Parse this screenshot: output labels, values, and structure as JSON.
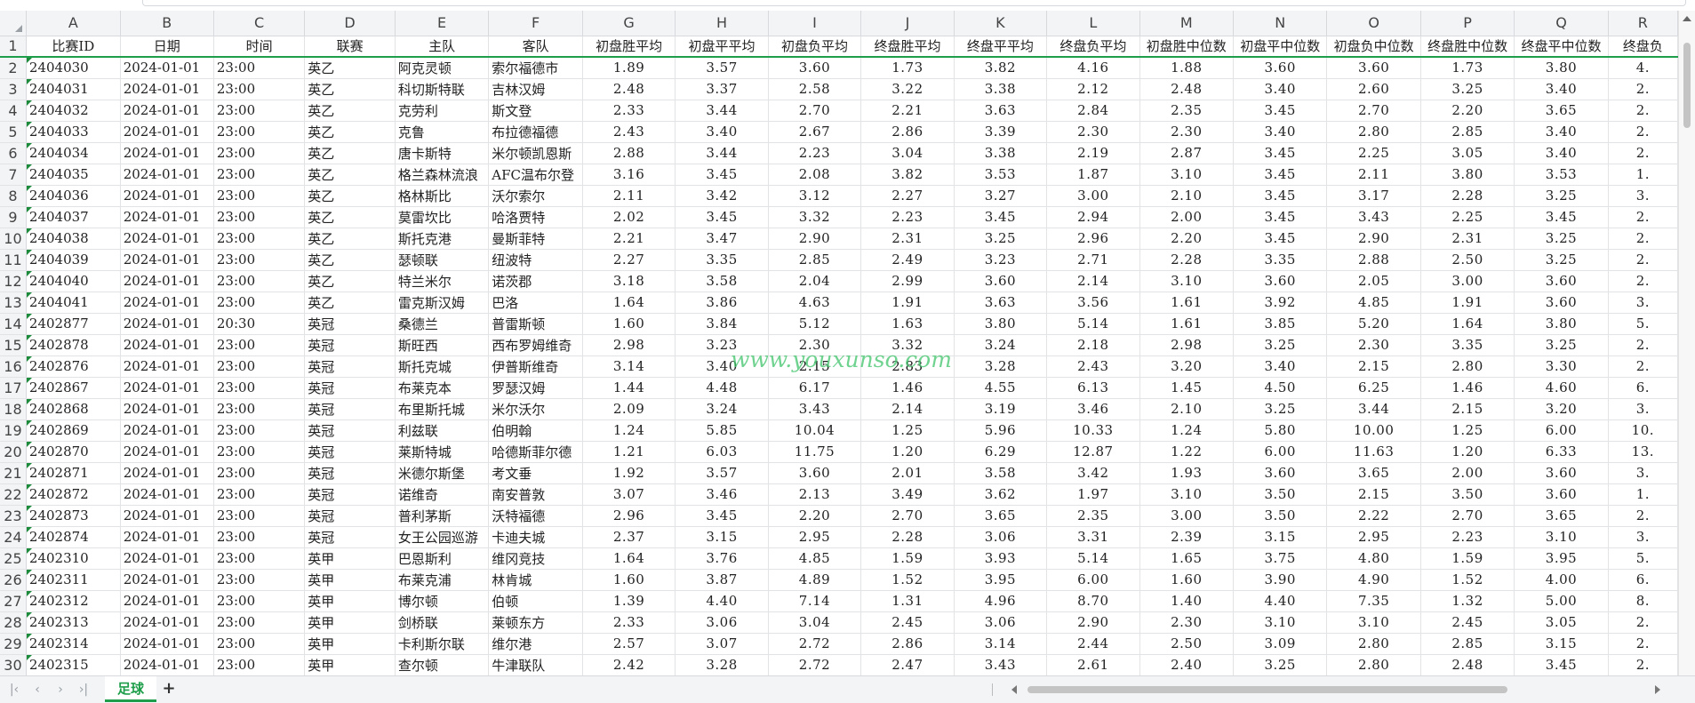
{
  "columns": [
    "A",
    "B",
    "C",
    "D",
    "E",
    "F",
    "G",
    "H",
    "I",
    "J",
    "K",
    "L",
    "M",
    "N",
    "O",
    "P",
    "Q",
    "R"
  ],
  "headers": [
    "比赛ID",
    "日期",
    "时间",
    "联赛",
    "主队",
    "客队",
    "初盘胜平均",
    "初盘平平均",
    "初盘负平均",
    "终盘胜平均",
    "终盘平平均",
    "终盘负平均",
    "初盘胜中位数",
    "初盘平中位数",
    "初盘负中位数",
    "终盘胜中位数",
    "终盘平中位数",
    "终盘负"
  ],
  "rows": [
    [
      "2",
      "2404030",
      "2024-01-01",
      "23:00",
      "英乙",
      "阿克灵顿",
      "索尔福德市",
      "1.89",
      "3.57",
      "3.60",
      "1.73",
      "3.82",
      "4.16",
      "1.88",
      "3.60",
      "3.60",
      "1.73",
      "3.80",
      "4."
    ],
    [
      "3",
      "2404031",
      "2024-01-01",
      "23:00",
      "英乙",
      "科切斯特联",
      "吉林汉姆",
      "2.48",
      "3.37",
      "2.58",
      "3.22",
      "3.38",
      "2.12",
      "2.48",
      "3.40",
      "2.60",
      "3.25",
      "3.40",
      "2."
    ],
    [
      "4",
      "2404032",
      "2024-01-01",
      "23:00",
      "英乙",
      "克劳利",
      "斯文登",
      "2.33",
      "3.44",
      "2.70",
      "2.21",
      "3.63",
      "2.84",
      "2.35",
      "3.45",
      "2.70",
      "2.20",
      "3.65",
      "2."
    ],
    [
      "5",
      "2404033",
      "2024-01-01",
      "23:00",
      "英乙",
      "克鲁",
      "布拉德福德",
      "2.43",
      "3.40",
      "2.67",
      "2.86",
      "3.39",
      "2.30",
      "2.30",
      "3.40",
      "2.80",
      "2.85",
      "3.40",
      "2."
    ],
    [
      "6",
      "2404034",
      "2024-01-01",
      "23:00",
      "英乙",
      "唐卡斯特",
      "米尔顿凯恩斯",
      "2.88",
      "3.44",
      "2.23",
      "3.04",
      "3.38",
      "2.19",
      "2.87",
      "3.45",
      "2.25",
      "3.05",
      "3.40",
      "2."
    ],
    [
      "7",
      "2404035",
      "2024-01-01",
      "23:00",
      "英乙",
      "格兰森林流浪",
      "AFC温布尔登",
      "3.16",
      "3.45",
      "2.08",
      "3.82",
      "3.53",
      "1.87",
      "3.10",
      "3.45",
      "2.11",
      "3.80",
      "3.53",
      "1."
    ],
    [
      "8",
      "2404036",
      "2024-01-01",
      "23:00",
      "英乙",
      "格林斯比",
      "沃尔索尔",
      "2.11",
      "3.42",
      "3.12",
      "2.27",
      "3.27",
      "3.00",
      "2.10",
      "3.45",
      "3.17",
      "2.28",
      "3.25",
      "3."
    ],
    [
      "9",
      "2404037",
      "2024-01-01",
      "23:00",
      "英乙",
      "莫雷坎比",
      "哈洛贾特",
      "2.02",
      "3.45",
      "3.32",
      "2.23",
      "3.45",
      "2.94",
      "2.00",
      "3.45",
      "3.43",
      "2.25",
      "3.45",
      "2."
    ],
    [
      "10",
      "2404038",
      "2024-01-01",
      "23:00",
      "英乙",
      "斯托克港",
      "曼斯菲特",
      "2.21",
      "3.47",
      "2.90",
      "2.31",
      "3.25",
      "2.96",
      "2.20",
      "3.45",
      "2.90",
      "2.31",
      "3.25",
      "2."
    ],
    [
      "11",
      "2404039",
      "2024-01-01",
      "23:00",
      "英乙",
      "瑟顿联",
      "纽波特",
      "2.27",
      "3.35",
      "2.85",
      "2.49",
      "3.23",
      "2.71",
      "2.28",
      "3.35",
      "2.88",
      "2.50",
      "3.25",
      "2."
    ],
    [
      "12",
      "2404040",
      "2024-01-01",
      "23:00",
      "英乙",
      "特兰米尔",
      "诺茨郡",
      "3.18",
      "3.58",
      "2.04",
      "2.99",
      "3.60",
      "2.14",
      "3.10",
      "3.60",
      "2.05",
      "3.00",
      "3.60",
      "2."
    ],
    [
      "13",
      "2404041",
      "2024-01-01",
      "23:00",
      "英乙",
      "雷克斯汉姆",
      "巴洛",
      "1.64",
      "3.86",
      "4.63",
      "1.91",
      "3.63",
      "3.56",
      "1.61",
      "3.92",
      "4.85",
      "1.91",
      "3.60",
      "3."
    ],
    [
      "14",
      "2402877",
      "2024-01-01",
      "20:30",
      "英冠",
      "桑德兰",
      "普雷斯顿",
      "1.60",
      "3.84",
      "5.12",
      "1.63",
      "3.80",
      "5.14",
      "1.61",
      "3.85",
      "5.20",
      "1.64",
      "3.80",
      "5."
    ],
    [
      "15",
      "2402878",
      "2024-01-01",
      "23:00",
      "英冠",
      "斯旺西",
      "西布罗姆维奇",
      "2.98",
      "3.23",
      "2.30",
      "3.32",
      "3.24",
      "2.18",
      "2.98",
      "3.25",
      "2.30",
      "3.35",
      "3.25",
      "2."
    ],
    [
      "16",
      "2402876",
      "2024-01-01",
      "23:00",
      "英冠",
      "斯托克城",
      "伊普斯维奇",
      "3.14",
      "3.40",
      "2.15",
      "2.83",
      "3.28",
      "2.43",
      "3.20",
      "3.40",
      "2.15",
      "2.80",
      "3.30",
      "2."
    ],
    [
      "17",
      "2402867",
      "2024-01-01",
      "23:00",
      "英冠",
      "布莱克本",
      "罗瑟汉姆",
      "1.44",
      "4.48",
      "6.17",
      "1.46",
      "4.55",
      "6.13",
      "1.45",
      "4.50",
      "6.25",
      "1.46",
      "4.60",
      "6."
    ],
    [
      "18",
      "2402868",
      "2024-01-01",
      "23:00",
      "英冠",
      "布里斯托城",
      "米尔沃尔",
      "2.09",
      "3.24",
      "3.43",
      "2.14",
      "3.19",
      "3.46",
      "2.10",
      "3.25",
      "3.44",
      "2.15",
      "3.20",
      "3."
    ],
    [
      "19",
      "2402869",
      "2024-01-01",
      "23:00",
      "英冠",
      "利兹联",
      "伯明翰",
      "1.24",
      "5.85",
      "10.04",
      "1.25",
      "5.96",
      "10.33",
      "1.24",
      "5.80",
      "10.00",
      "1.25",
      "6.00",
      "10."
    ],
    [
      "20",
      "2402870",
      "2024-01-01",
      "23:00",
      "英冠",
      "莱斯特城",
      "哈德斯菲尔德",
      "1.21",
      "6.03",
      "11.75",
      "1.20",
      "6.29",
      "12.87",
      "1.22",
      "6.00",
      "11.63",
      "1.20",
      "6.33",
      "13."
    ],
    [
      "21",
      "2402871",
      "2024-01-01",
      "23:00",
      "英冠",
      "米德尔斯堡",
      "考文垂",
      "1.92",
      "3.57",
      "3.60",
      "2.01",
      "3.58",
      "3.42",
      "1.93",
      "3.60",
      "3.65",
      "2.00",
      "3.60",
      "3."
    ],
    [
      "22",
      "2402872",
      "2024-01-01",
      "23:00",
      "英冠",
      "诺维奇",
      "南安普敦",
      "3.07",
      "3.46",
      "2.13",
      "3.49",
      "3.62",
      "1.97",
      "3.10",
      "3.50",
      "2.15",
      "3.50",
      "3.60",
      "1."
    ],
    [
      "23",
      "2402873",
      "2024-01-01",
      "23:00",
      "英冠",
      "普利茅斯",
      "沃特福德",
      "2.96",
      "3.45",
      "2.20",
      "2.70",
      "3.65",
      "2.35",
      "3.00",
      "3.50",
      "2.22",
      "2.70",
      "3.65",
      "2."
    ],
    [
      "24",
      "2402874",
      "2024-01-01",
      "23:00",
      "英冠",
      "女王公园巡游",
      "卡迪夫城",
      "2.37",
      "3.15",
      "2.95",
      "2.28",
      "3.06",
      "3.31",
      "2.39",
      "3.15",
      "2.95",
      "2.23",
      "3.10",
      "3."
    ],
    [
      "25",
      "2402310",
      "2024-01-01",
      "23:00",
      "英甲",
      "巴恩斯利",
      "维冈竞技",
      "1.64",
      "3.76",
      "4.85",
      "1.59",
      "3.93",
      "5.14",
      "1.65",
      "3.75",
      "4.80",
      "1.59",
      "3.95",
      "5."
    ],
    [
      "26",
      "2402311",
      "2024-01-01",
      "23:00",
      "英甲",
      "布莱克浦",
      "林肯城",
      "1.60",
      "3.87",
      "4.89",
      "1.52",
      "3.95",
      "6.00",
      "1.60",
      "3.90",
      "4.90",
      "1.52",
      "4.00",
      "6."
    ],
    [
      "27",
      "2402312",
      "2024-01-01",
      "23:00",
      "英甲",
      "博尔顿",
      "伯顿",
      "1.39",
      "4.40",
      "7.14",
      "1.31",
      "4.96",
      "8.70",
      "1.40",
      "4.40",
      "7.35",
      "1.32",
      "5.00",
      "8."
    ],
    [
      "28",
      "2402313",
      "2024-01-01",
      "23:00",
      "英甲",
      "剑桥联",
      "莱顿东方",
      "2.33",
      "3.06",
      "3.04",
      "2.45",
      "3.06",
      "2.90",
      "2.30",
      "3.10",
      "3.10",
      "2.45",
      "3.05",
      "2."
    ],
    [
      "29",
      "2402314",
      "2024-01-01",
      "23:00",
      "英甲",
      "卡利斯尔联",
      "维尔港",
      "2.57",
      "3.07",
      "2.72",
      "2.86",
      "3.14",
      "2.44",
      "2.50",
      "3.09",
      "2.80",
      "2.85",
      "3.15",
      "2."
    ],
    [
      "30",
      "2402315",
      "2024-01-01",
      "23:00",
      "英甲",
      "查尔顿",
      "牛津联队",
      "2.42",
      "3.28",
      "2.72",
      "2.47",
      "3.43",
      "2.61",
      "2.40",
      "3.25",
      "2.80",
      "2.48",
      "3.45",
      "2."
    ]
  ],
  "watermark": "www.youxunso.com",
  "sheet_tab": "足球",
  "nav": {
    "first": "|‹",
    "prev": "‹",
    "next": "›",
    "last": "›|",
    "add": "+"
  },
  "colors": {
    "accent": "#1e9e4a",
    "header_bg": "#f3f4f6",
    "grid_line": "#e2e3e5"
  }
}
